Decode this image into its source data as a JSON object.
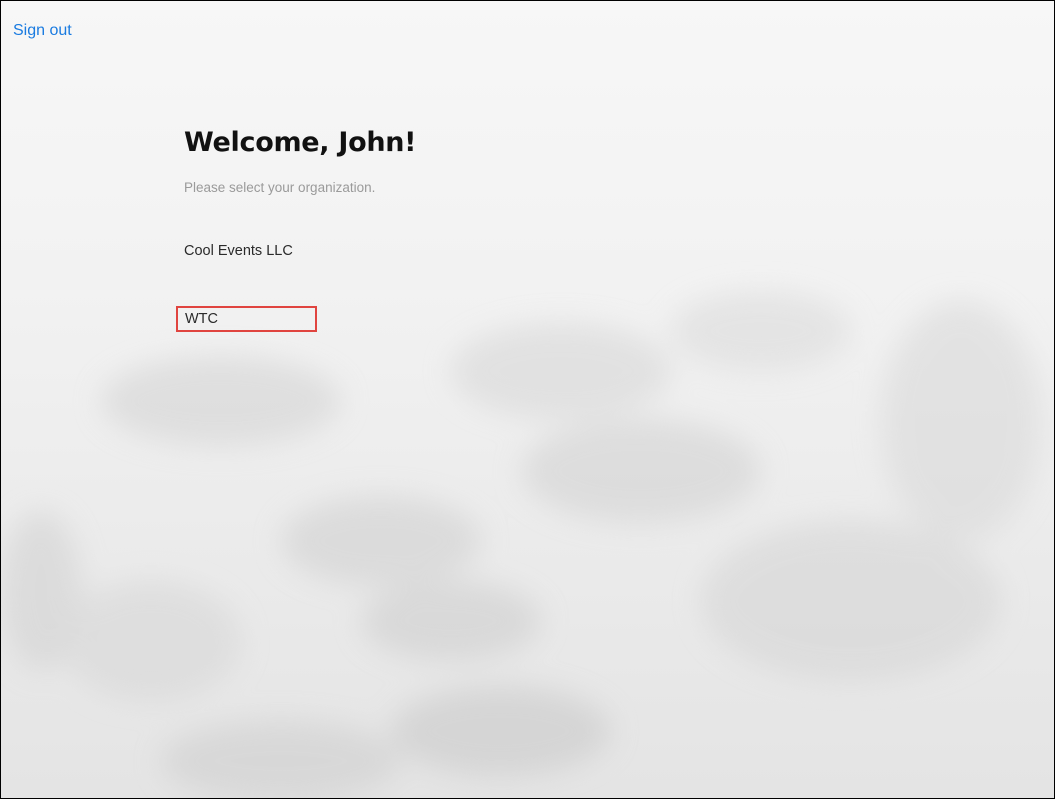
{
  "header": {
    "sign_out_label": "Sign out"
  },
  "main": {
    "title": "Welcome, John!",
    "subtitle": "Please select your organization.",
    "organizations": [
      {
        "label": "Cool Events LLC",
        "highlighted": false
      },
      {
        "label": "WTC",
        "highlighted": true
      }
    ]
  },
  "colors": {
    "link": "#1a7be0",
    "highlight_border": "#e0443f",
    "background": "#f6f6f6"
  }
}
